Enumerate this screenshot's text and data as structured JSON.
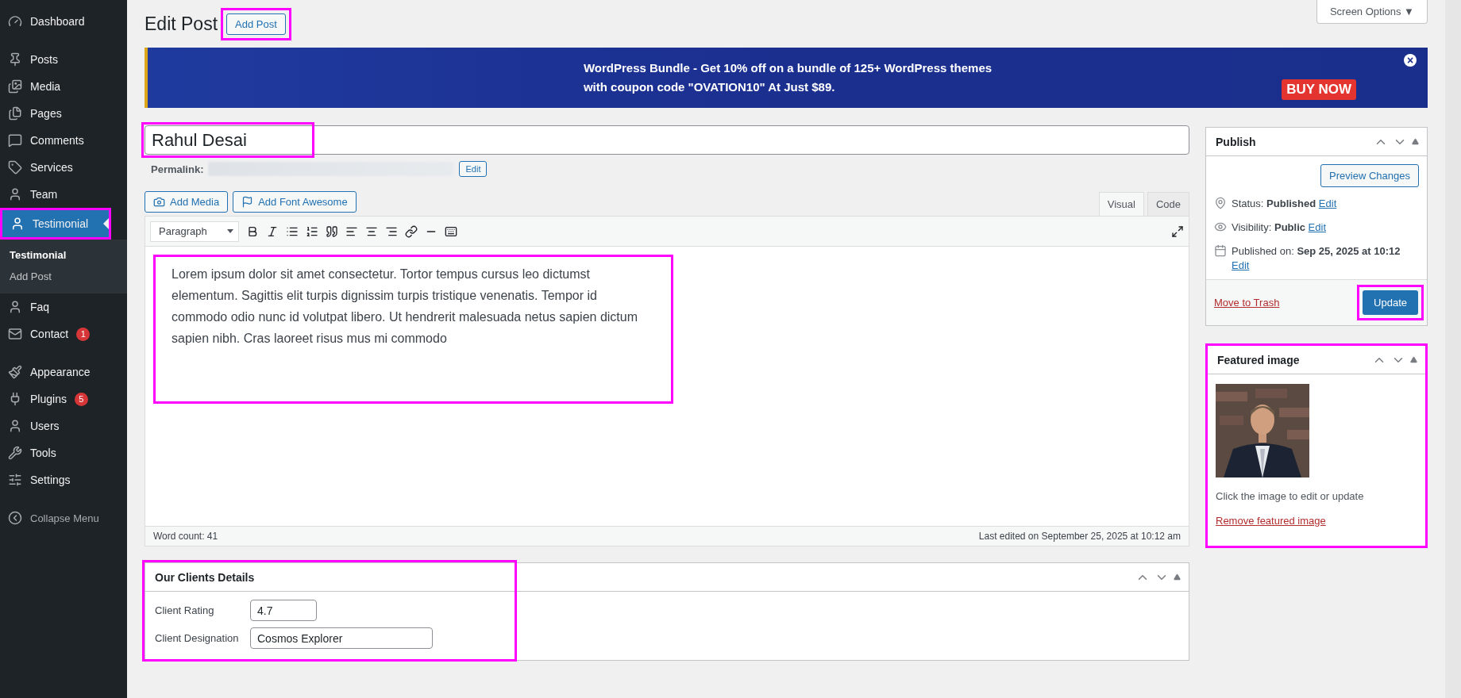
{
  "sidebar": {
    "groups": [
      [
        {
          "label": "Dashboard",
          "selected": false,
          "highlighted": false
        }
      ],
      [
        {
          "label": "Posts",
          "selected": false,
          "highlighted": false
        },
        {
          "label": "Media",
          "selected": false,
          "highlighted": false
        },
        {
          "label": "Pages",
          "selected": false,
          "highlighted": false
        },
        {
          "label": "Comments",
          "selected": false,
          "highlighted": false
        },
        {
          "label": "Services",
          "selected": false,
          "highlighted": false
        },
        {
          "label": "Team",
          "selected": false,
          "highlighted": false
        },
        {
          "label": "Testimonial",
          "selected": true,
          "highlighted": true,
          "children": [
            {
              "label": "Testimonial",
              "selected": true
            },
            {
              "label": "Add Post",
              "selected": false
            }
          ]
        },
        {
          "label": "Faq",
          "selected": false,
          "highlighted": false
        },
        {
          "label": "Contact",
          "selected": false,
          "highlighted": false,
          "badge": "1"
        }
      ],
      [
        {
          "label": "Appearance",
          "selected": false,
          "highlighted": false
        },
        {
          "label": "Plugins",
          "selected": false,
          "highlighted": false,
          "badge": "5"
        },
        {
          "label": "Users",
          "selected": false,
          "highlighted": false
        },
        {
          "label": "Tools",
          "selected": false,
          "highlighted": false
        },
        {
          "label": "Settings",
          "selected": false,
          "highlighted": false
        }
      ]
    ],
    "collapse": "Collapse Menu"
  },
  "header": {
    "title": "Edit Post",
    "add_button": "Add Post",
    "add_highlighted": true,
    "screen_options": "Screen Options ▼"
  },
  "banner": {
    "line1": "WordPress Bundle - Get 10% off on a bundle of 125+ WordPress themes",
    "line2": "with coupon code \"OVATION10\" At Just $89.",
    "cta": "BUY NOW",
    "close": "×"
  },
  "post": {
    "title": "Rahul Desai",
    "title_highlighted": true,
    "permalink_label": "Permalink:",
    "permalink_edit": "Edit"
  },
  "media_buttons": [
    "Add Media",
    "Add Font Awesome"
  ],
  "editor": {
    "tabs": [
      {
        "label": "Visual",
        "selected": true
      },
      {
        "label": "Code",
        "selected": false
      }
    ],
    "format": "Paragraph",
    "content": "Lorem ipsum dolor sit amet consectetur. Tortor tempus cursus leo dictumst elementum. Sagittis elit turpis dignissim turpis tristique venenatis. Tempor id commodo odio nunc id volutpat libero. Ut hendrerit malesuada netus sapien dictum sapien nibh. Cras laoreet risus mus mi commodo",
    "content_highlighted": true,
    "word_count": "Word count: 41",
    "last_edited": "Last edited on September 25, 2025 at 10:12 am"
  },
  "clients_box": {
    "title": "Our Clients Details",
    "highlighted": true,
    "fields": [
      {
        "label": "Client Rating",
        "value": "4.7"
      },
      {
        "label": "Client Designation",
        "value": "Cosmos Explorer"
      }
    ]
  },
  "publish": {
    "title": "Publish",
    "preview": "Preview Changes",
    "rows": [
      {
        "label": "Status:",
        "value": "Published",
        "edit": "Edit"
      },
      {
        "label": "Visibility:",
        "value": "Public",
        "edit": "Edit"
      },
      {
        "label": "Published on:",
        "value": "Sep 25, 2025 at 10:12",
        "edit": "Edit"
      }
    ],
    "trash": "Move to Trash",
    "update": "Update",
    "update_highlighted": true
  },
  "featured": {
    "title": "Featured image",
    "highlighted": true,
    "hint": "Click the image to edit or update",
    "remove": "Remove featured image"
  }
}
